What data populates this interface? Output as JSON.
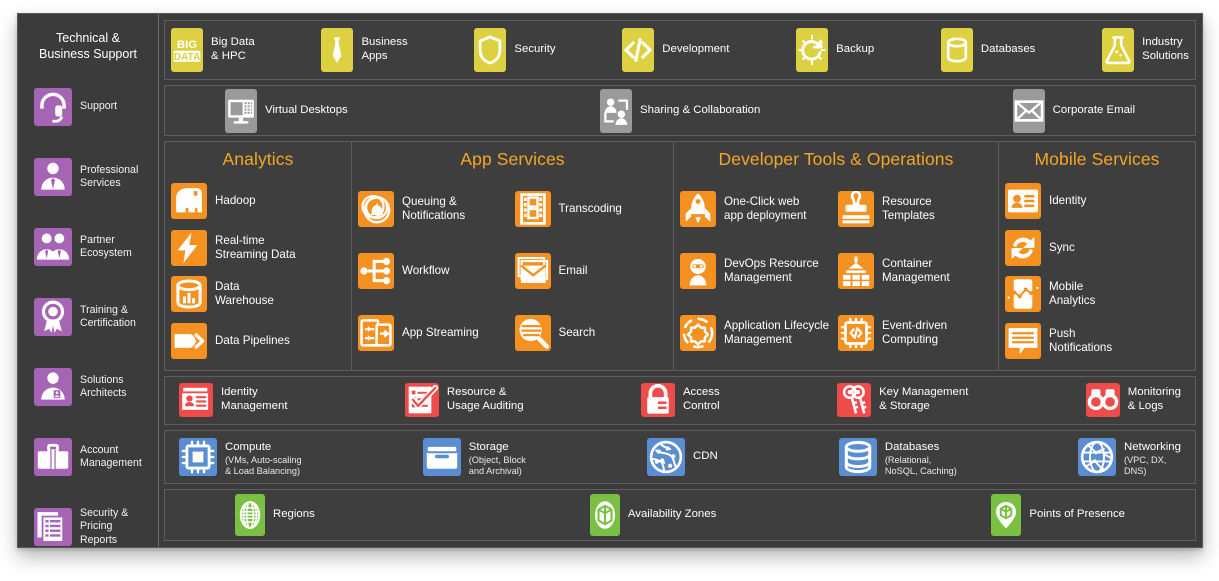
{
  "colors": {
    "purple": "#a664b4",
    "yellow": "#ddd142",
    "gray": "#9a9a9a",
    "orange": "#f59120",
    "red": "#ef4b4b",
    "blue": "#5b8ed0",
    "green": "#7ac043",
    "panel_bg": "#3b3b3b",
    "band_bg": "#3e3e3e",
    "heading": "#f5a623"
  },
  "sidebar": {
    "title": "Technical &\nBusiness Support",
    "items": [
      {
        "label": "Support",
        "icon": "headset-icon"
      },
      {
        "label": "Professional\nServices",
        "icon": "person-tie-icon"
      },
      {
        "label": "Partner\nEcosystem",
        "icon": "two-people-icon"
      },
      {
        "label": "Training &\nCertification",
        "icon": "award-ribbon-icon"
      },
      {
        "label": "Solutions\nArchitects",
        "icon": "person-badge-icon"
      },
      {
        "label": "Account\nManagement",
        "icon": "briefcase-icon"
      },
      {
        "label": "Security &\nPricing Reports",
        "icon": "documents-icon"
      }
    ]
  },
  "top_band": {
    "items": [
      {
        "label": "Big Data\n& HPC",
        "icon": "big-data-icon"
      },
      {
        "label": "Business\nApps",
        "icon": "necktie-icon"
      },
      {
        "label": "Security",
        "icon": "shield-icon"
      },
      {
        "label": "Development",
        "icon": "code-brackets-icon"
      },
      {
        "label": "Backup",
        "icon": "refresh-sun-icon"
      },
      {
        "label": "Databases",
        "icon": "database-cylinder-icon"
      },
      {
        "label": "Industry\nSolutions",
        "icon": "flask-icon"
      }
    ]
  },
  "gray_band": {
    "items": [
      {
        "label": "Virtual Desktops",
        "icon": "desktop-monitor-icon"
      },
      {
        "label": "Sharing & Collaboration",
        "icon": "people-share-icon"
      },
      {
        "label": "Corporate Email",
        "icon": "envelope-icon"
      }
    ]
  },
  "columns": [
    {
      "title": "Analytics",
      "cols": 1,
      "items": [
        {
          "label": "Hadoop",
          "icon": "elephant-icon"
        },
        {
          "label": "Real-time\nStreaming Data",
          "icon": "lightning-bolt-icon"
        },
        {
          "label": "Data\nWarehouse",
          "icon": "data-warehouse-icon"
        },
        {
          "label": "Data Pipelines",
          "icon": "pipeline-arrow-icon"
        }
      ]
    },
    {
      "title": "App Services",
      "cols": 2,
      "items": [
        {
          "label": "Queuing &\nNotifications",
          "icon": "bell-stack-icon"
        },
        {
          "label": "Transcoding",
          "icon": "film-strip-icon"
        },
        {
          "label": "Workflow",
          "icon": "workflow-nodes-icon"
        },
        {
          "label": "Email",
          "icon": "email-stack-icon"
        },
        {
          "label": "App Streaming",
          "icon": "app-streaming-icon"
        },
        {
          "label": "Search",
          "icon": "magnifier-icon"
        }
      ]
    },
    {
      "title": "Developer Tools & Operations",
      "cols": 2,
      "items": [
        {
          "label": "One-Click web\napp deployment",
          "icon": "rocket-icon"
        },
        {
          "label": "Resource\nTemplates",
          "icon": "rubber-stamp-icon"
        },
        {
          "label": "DevOps Resource\nManagement",
          "icon": "devops-person-icon"
        },
        {
          "label": "Container\nManagement",
          "icon": "containers-icon"
        },
        {
          "label": "Application Lifecycle\nManagement",
          "icon": "lifecycle-gear-icon"
        },
        {
          "label": "Event-driven\nComputing",
          "icon": "chip-code-icon"
        }
      ]
    },
    {
      "title": "Mobile Services",
      "cols": 1,
      "items": [
        {
          "label": "Identity",
          "icon": "id-card-icon"
        },
        {
          "label": "Sync",
          "icon": "sync-arrows-icon"
        },
        {
          "label": "Mobile\nAnalytics",
          "icon": "mobile-chart-icon"
        },
        {
          "label": "Push\nNotifications",
          "icon": "speech-lines-icon"
        }
      ]
    }
  ],
  "red_band": {
    "items": [
      {
        "label": "Identity\nManagement",
        "icon": "id-cards-icon"
      },
      {
        "label": "Resource &\nUsage Auditing",
        "icon": "checklist-icon"
      },
      {
        "label": "Access\nControl",
        "icon": "padlock-icon"
      },
      {
        "label": "Key Management\n& Storage",
        "icon": "keys-icon"
      },
      {
        "label": "Monitoring\n& Logs",
        "icon": "binoculars-icon"
      }
    ]
  },
  "blue_band": {
    "items": [
      {
        "label": "Compute",
        "sub": "(VMs, Auto-scaling\n& Load Balancing)",
        "icon": "cpu-chip-icon"
      },
      {
        "label": "Storage",
        "sub": "(Object, Block\nand Archival)",
        "icon": "storage-box-icon"
      },
      {
        "label": "CDN",
        "sub": "",
        "icon": "cdn-globe-icon"
      },
      {
        "label": "Databases",
        "sub": "(Relational,\nNoSQL, Caching)",
        "icon": "db-cylinder-icon"
      },
      {
        "label": "Networking",
        "sub": "(VPC, DX,\nDNS)",
        "icon": "network-globe-icon"
      }
    ]
  },
  "green_band": {
    "items": [
      {
        "label": "Regions",
        "icon": "globe-grid-icon"
      },
      {
        "label": "Availability Zones",
        "icon": "zone-cube-icon"
      },
      {
        "label": "Points of Presence",
        "icon": "map-pin-icon"
      }
    ]
  }
}
